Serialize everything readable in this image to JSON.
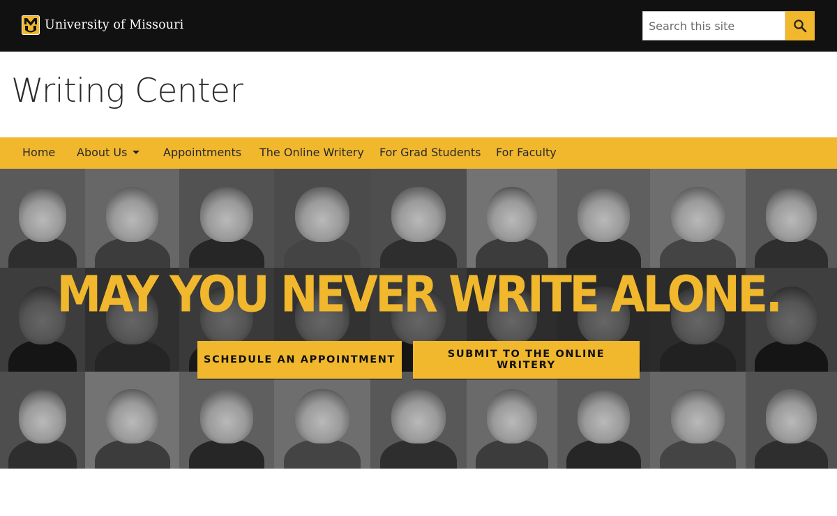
{
  "header": {
    "university": "University of Missouri",
    "search": {
      "placeholder": "Search this site",
      "value": ""
    },
    "search_icon": "search-icon"
  },
  "site": {
    "title": "Writing Center"
  },
  "nav": {
    "items": [
      {
        "label": "Home"
      },
      {
        "label": "About Us",
        "has_dropdown": true
      },
      {
        "label": "Appointments"
      },
      {
        "label": "The Online Writery"
      },
      {
        "label": "For Grad Students"
      },
      {
        "label": "For Faculty"
      }
    ]
  },
  "hero": {
    "headline": "MAY YOU NEVER WRITE ALONE.",
    "buttons": [
      {
        "label": "SCHEDULE AN APPOINTMENT"
      },
      {
        "label": "SUBMIT TO THE ONLINE WRITERY"
      }
    ]
  },
  "colors": {
    "gold": "#F1B82D",
    "black": "#111111",
    "white": "#FFFFFF"
  }
}
